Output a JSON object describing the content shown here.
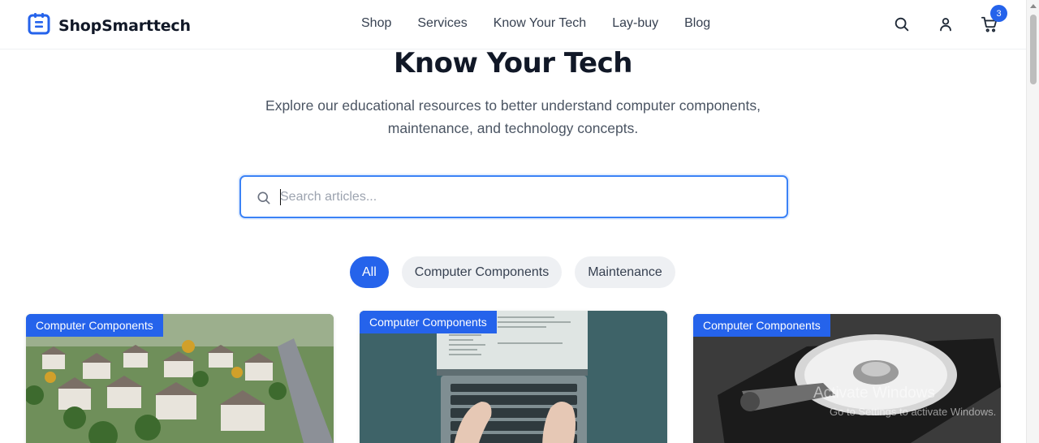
{
  "nav": {
    "brand": "ShopSmarttech",
    "links": [
      "Shop",
      "Services",
      "Know Your Tech",
      "Lay-buy",
      "Blog"
    ],
    "cart_count": "3"
  },
  "hero": {
    "title": "Know Your Tech",
    "subtitle": "Explore our educational resources to better understand computer components, maintenance, and technology concepts."
  },
  "search": {
    "placeholder": "Search articles...",
    "value": ""
  },
  "filters": [
    "All",
    "Computer Components",
    "Maintenance"
  ],
  "cards": [
    {
      "category": "Computer Components"
    },
    {
      "category": "Computer Components"
    },
    {
      "category": "Computer Components"
    }
  ],
  "watermark": {
    "line1": "Activate Windows",
    "line2": "Go to Settings to activate Windows."
  },
  "colors": {
    "accent": "#2563eb",
    "text_dark": "#111827",
    "pill_bg": "#eef0f3"
  }
}
